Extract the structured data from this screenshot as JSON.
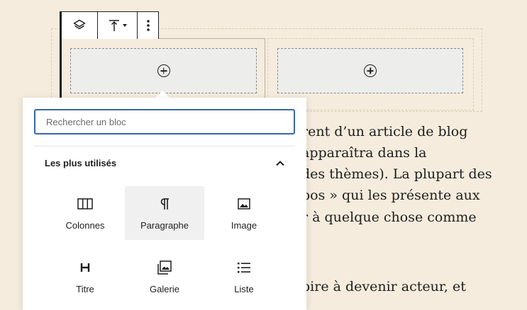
{
  "toolbar": {
    "parent_icon": "layers-icon",
    "align_icon": "align-top-icon",
    "more_icon": "more-vertical-icon"
  },
  "columns": [
    {
      "appender_icon": "plus-circle-icon"
    },
    {
      "appender_icon": "plus-circle-icon"
    }
  ],
  "background_text": [
    "rent d’un article de blog",
    "apparaîtra dans la",
    "des thèmes). La plupart des",
    "pos » qui les présente aux",
    "r à quelque chose comme",
    "pire à devenir acteur, et"
  ],
  "inserter": {
    "search_placeholder": "Rechercher un bloc",
    "section_title": "Les plus utilisés",
    "collapse_icon": "chevron-up-icon",
    "blocks": [
      {
        "label": "Colonnes",
        "icon": "columns-icon"
      },
      {
        "label": "Paragraphe",
        "icon": "paragraph-icon"
      },
      {
        "label": "Image",
        "icon": "image-icon"
      },
      {
        "label": "Titre",
        "icon": "heading-icon"
      },
      {
        "label": "Galerie",
        "icon": "gallery-icon"
      },
      {
        "label": "Liste",
        "icon": "list-icon"
      }
    ]
  },
  "colors": {
    "page_background": "#f5ecdd",
    "focus_accent": "#3568a8",
    "text": "#1e1e1e"
  }
}
